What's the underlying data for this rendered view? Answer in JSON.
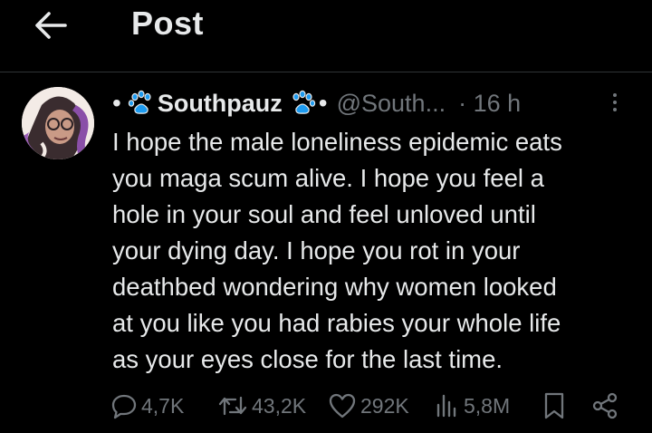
{
  "header": {
    "title": "Post",
    "back_icon": "arrow-left-icon"
  },
  "post": {
    "bullet": "•",
    "display_name": "Southpauz",
    "name_decoration_icon": "paw-prints-icon",
    "separator": "•",
    "handle": "@South...",
    "time": "· 16 h",
    "more_icon": "more-vertical-icon",
    "text": "I hope the male loneliness epidemic eats\nyou maga scum alive. I hope you feel a\nhole in your soul and feel unloved until\nyour dying day. I hope you rot in your\ndeathbed wondering why women looked\nat you like you had rabies your whole life\nas your eyes close for the last time."
  },
  "actions": {
    "replies": "4,7K",
    "reposts": "43,2K",
    "likes": "292K",
    "views": "5,8M",
    "reply_icon": "reply-icon",
    "repost_icon": "repost-icon",
    "like_icon": "heart-icon",
    "views_icon": "views-chart-icon",
    "bookmark_icon": "bookmark-icon",
    "share_icon": "share-icon"
  },
  "colors": {
    "background": "#000000",
    "text_primary": "#e7e9ea",
    "text_secondary": "#71767b",
    "divider": "#2f3336",
    "paw_accent": "#1d9bf0"
  }
}
